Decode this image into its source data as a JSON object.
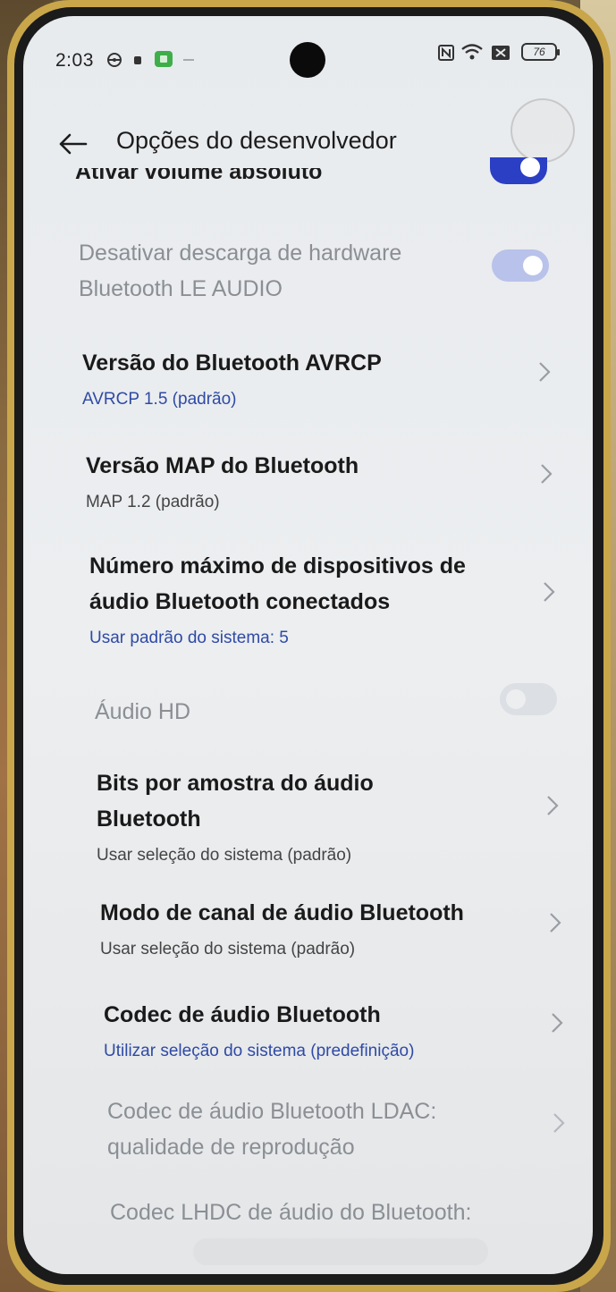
{
  "status_bar": {
    "time": "2:03",
    "battery": "76",
    "left_icons": [
      "steering-icon",
      "notification-dot-icon",
      "app-icon",
      "dash-icon"
    ],
    "right_icons": [
      "nfc-icon",
      "wifi-icon",
      "sim-icon",
      "battery-icon"
    ]
  },
  "header": {
    "title": "Opções do desenvolvedor",
    "back_icon": "arrow-left-icon"
  },
  "partial_row": {
    "title": "Ativar volume absoluto",
    "toggle_on": true
  },
  "rows": [
    {
      "title_lines": [
        "Desativar descarga de hardware",
        "Bluetooth LE AUDIO"
      ],
      "disabled": true,
      "control": "toggle",
      "toggle_on": true
    },
    {
      "title_lines": [
        "Versão do Bluetooth AVRCP"
      ],
      "subtitle": "AVRCP 1.5 (padrão)",
      "subtitle_color": "blue",
      "control": "chevron"
    },
    {
      "title_lines": [
        "Versão MAP do Bluetooth"
      ],
      "subtitle": "MAP 1.2 (padrão)",
      "subtitle_color": "gray",
      "control": "chevron"
    },
    {
      "title_lines": [
        "Número máximo de dispositivos de",
        "áudio Bluetooth conectados"
      ],
      "subtitle": "Usar padrão do sistema: 5",
      "subtitle_color": "blue",
      "control": "chevron"
    },
    {
      "title_lines": [
        "Áudio HD"
      ],
      "disabled": true,
      "control": "toggle",
      "toggle_on": false
    },
    {
      "title_lines": [
        "Bits por amostra do áudio",
        "Bluetooth"
      ],
      "subtitle": "Usar seleção do sistema (padrão)",
      "subtitle_color": "gray",
      "control": "chevron"
    },
    {
      "title_lines": [
        "Modo de canal de áudio Bluetooth"
      ],
      "subtitle": "Usar seleção do sistema (padrão)",
      "subtitle_color": "gray",
      "control": "chevron"
    },
    {
      "title_lines": [
        "Codec de áudio Bluetooth"
      ],
      "subtitle": "Utilizar seleção do sistema (predefinição)",
      "subtitle_color": "blue",
      "control": "chevron"
    },
    {
      "title_lines": [
        "Codec de áudio Bluetooth LDAC:",
        "qualidade de reprodução"
      ],
      "disabled": true,
      "control": "chevron"
    },
    {
      "title_lines": [
        "Codec LHDC de áudio do Bluetooth:"
      ],
      "disabled": true,
      "control": "chevron"
    }
  ],
  "colors": {
    "accent": "#2b3fc4",
    "accent_disabled": "#b8c2ea",
    "subtitle_blue": "#2f4aa5",
    "disabled_text": "#8b8f94"
  }
}
